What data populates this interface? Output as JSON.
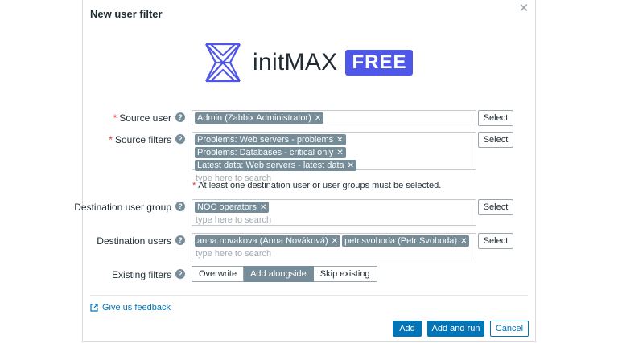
{
  "dialog": {
    "title": "New user filter"
  },
  "logo": {
    "name": "initMAX",
    "badge": "FREE",
    "colors": {
      "primary": "#4f57e8",
      "dark": "#1f2c33"
    }
  },
  "form": {
    "source_user": {
      "label": "Source user",
      "required": "*",
      "chips": [
        "Admin (Zabbix Administrator)"
      ],
      "select_label": "Select"
    },
    "source_filters": {
      "label": "Source filters",
      "required": "*",
      "chips": [
        "Problems: Web servers - problems",
        "Problems: Databases - critical only",
        "Latest data: Web servers - latest data"
      ],
      "placeholder": "type here to search",
      "select_label": "Select"
    },
    "note": "At least one destination user or user groups must be selected.",
    "note_marker": "*",
    "destination_user_group": {
      "label": "Destination user group",
      "chips": [
        "NOC operators"
      ],
      "placeholder": "type here to search",
      "select_label": "Select"
    },
    "destination_users": {
      "label": "Destination users",
      "chips": [
        "anna.novakova (Anna Nováková)",
        "petr.svoboda (Petr Svoboda)"
      ],
      "placeholder": "type here to search",
      "select_label": "Select"
    },
    "existing_filters": {
      "label": "Existing filters",
      "options": [
        "Overwrite",
        "Add alongside",
        "Skip existing"
      ],
      "selected": "Add alongside"
    },
    "help_glyph": "?"
  },
  "footer": {
    "feedback": "Give us feedback",
    "add": "Add",
    "add_and_run": "Add and run",
    "cancel": "Cancel"
  },
  "icons": {
    "close": "close-icon",
    "help": "help-icon",
    "chip_remove": "remove-icon",
    "feedback": "external-link-icon"
  },
  "accent_color": "#0275b8",
  "chip_color": "#768d99"
}
